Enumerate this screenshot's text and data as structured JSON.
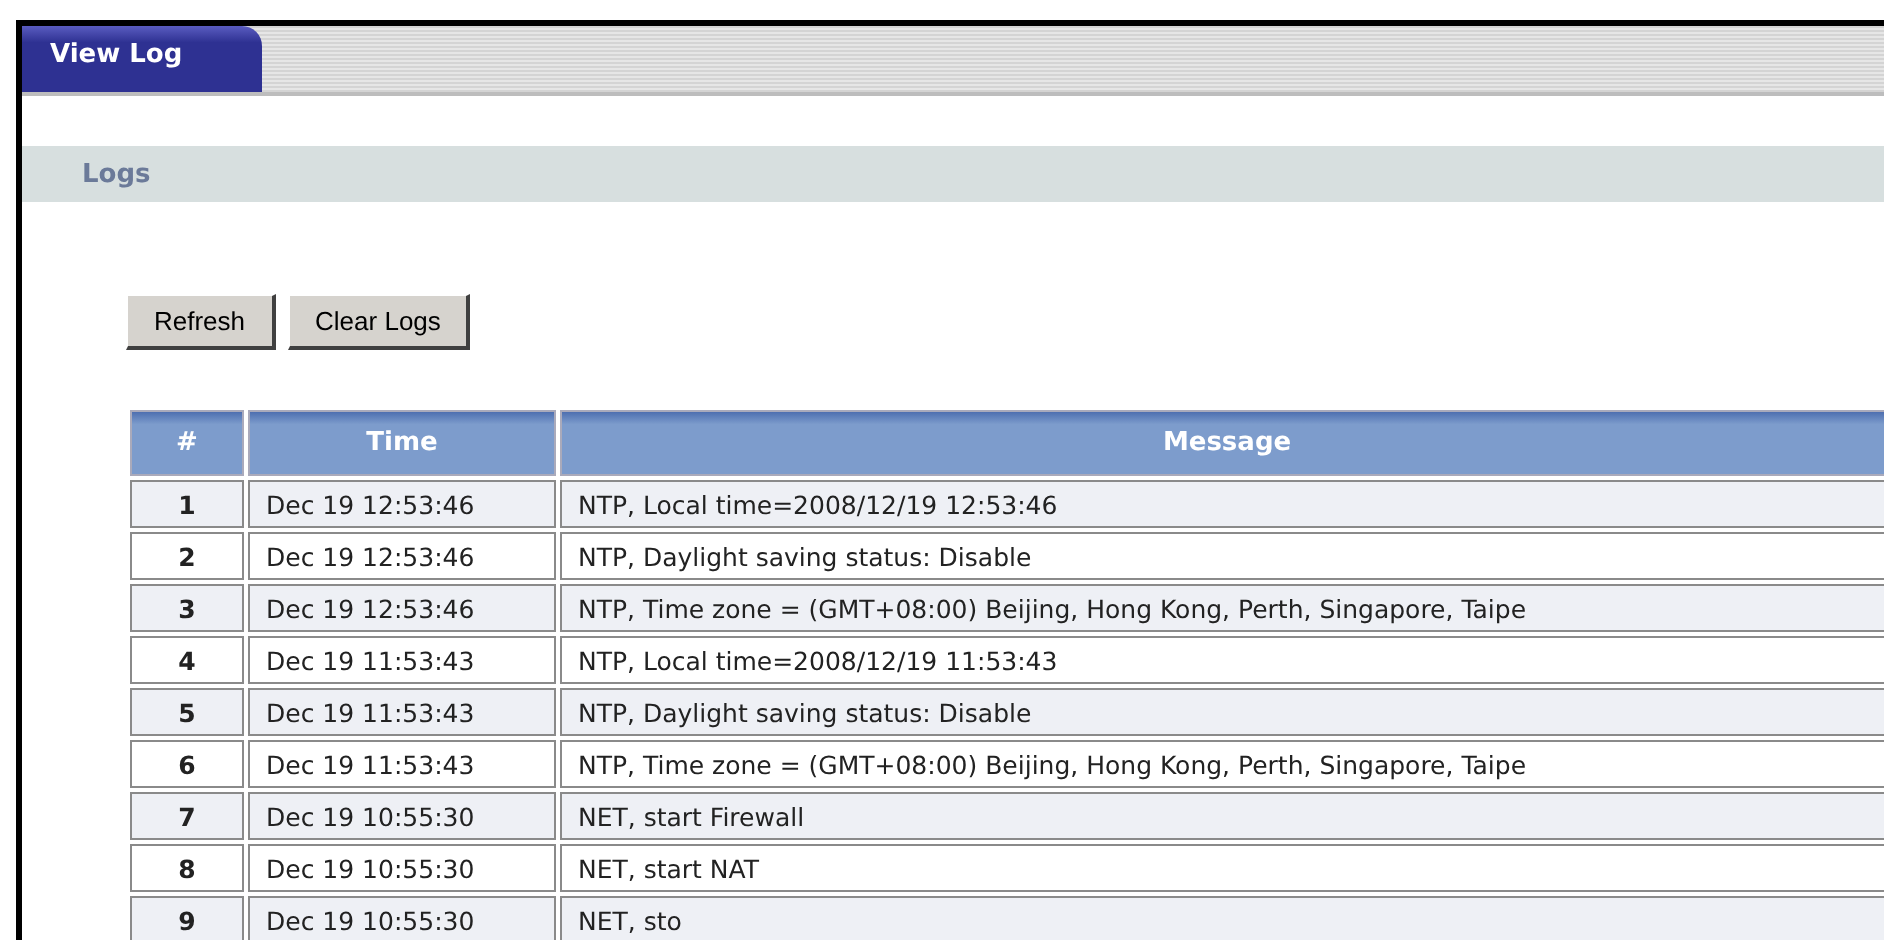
{
  "tabs": [
    {
      "label": "View Log",
      "selected": true
    }
  ],
  "section": {
    "title": "Logs"
  },
  "buttons": [
    "Refresh",
    "Clear Logs"
  ],
  "table": {
    "columns": [
      "#",
      "Time",
      "Message"
    ],
    "rows": [
      {
        "cells": [
          "1",
          "Dec 19 12:53:46",
          "NTP, Local time=2008/12/19 12:53:46"
        ]
      },
      {
        "cells": [
          "2",
          "Dec 19 12:53:46",
          "NTP, Daylight saving status: Disable"
        ]
      },
      {
        "cells": [
          "3",
          "Dec 19 12:53:46",
          "NTP, Time zone = (GMT+08:00) Beijing, Hong Kong, Perth, Singapore, Taipe"
        ]
      },
      {
        "cells": [
          "4",
          "Dec 19 11:53:43",
          "NTP, Local time=2008/12/19 11:53:43"
        ]
      },
      {
        "cells": [
          "5",
          "Dec 19 11:53:43",
          "NTP, Daylight saving status: Disable"
        ]
      },
      {
        "cells": [
          "6",
          "Dec 19 11:53:43",
          "NTP, Time zone = (GMT+08:00) Beijing, Hong Kong, Perth, Singapore, Taipe"
        ]
      },
      {
        "cells": [
          "7",
          "Dec 19 10:55:30",
          "NET, start Firewall"
        ]
      },
      {
        "cells": [
          "8",
          "Dec 19 10:55:30",
          "NET, start NAT"
        ]
      },
      {
        "cells": [
          "9",
          "Dec 19 10:55:30",
          "NET, sto"
        ]
      }
    ]
  }
}
